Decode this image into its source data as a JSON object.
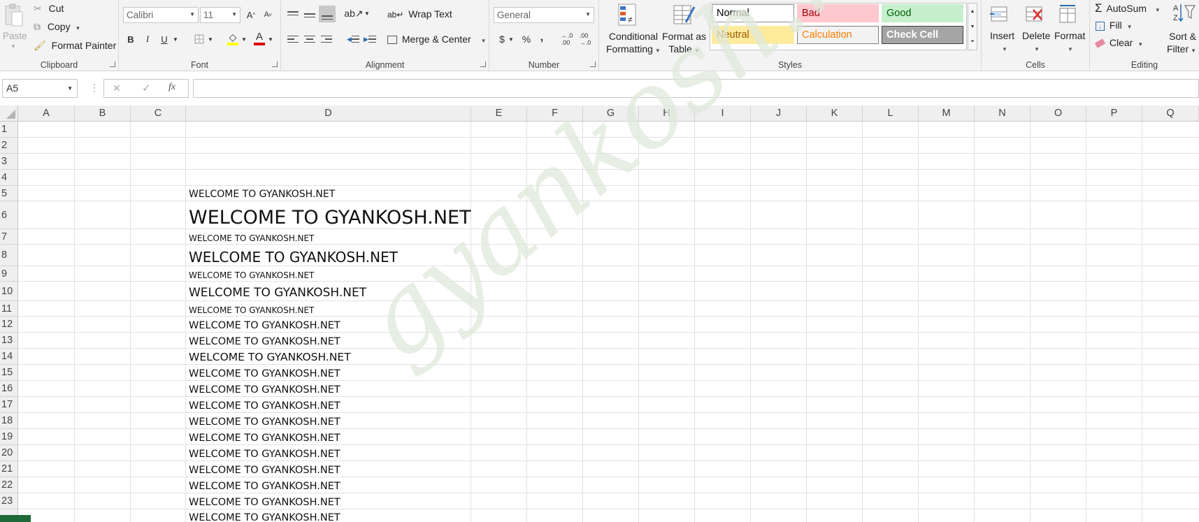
{
  "clipboard": {
    "paste": "Paste",
    "cut": "Cut",
    "copy": "Copy",
    "format_painter": "Format Painter",
    "title": "Clipboard"
  },
  "font": {
    "name": "Calibri",
    "size": "11",
    "bold": "B",
    "italic": "I",
    "underline": "U",
    "title": "Font"
  },
  "alignment": {
    "wrap_text": "Wrap Text",
    "merge_center": "Merge & Center",
    "title": "Alignment"
  },
  "number": {
    "format": "General",
    "currency": "$",
    "percent": "%",
    "comma": ",",
    "title": "Number"
  },
  "styles_group": {
    "conditional_formatting": [
      "Conditional",
      "Formatting"
    ],
    "format_as_table": [
      "Format as",
      "Table"
    ],
    "items": [
      {
        "label": "Normal",
        "bg": "#ffffff",
        "color": "#000000",
        "border": "#8f8f8f"
      },
      {
        "label": "Bad",
        "bg": "#ffc7ce",
        "color": "#9c0006",
        "border": "#ffc7ce"
      },
      {
        "label": "Good",
        "bg": "#c6efce",
        "color": "#006100",
        "border": "#c6efce"
      },
      {
        "label": "Neutral",
        "bg": "#ffeb9c",
        "color": "#9c5700",
        "border": "#ffeb9c"
      },
      {
        "label": "Calculation",
        "bg": "#f2f2f2",
        "color": "#fa7d00",
        "border": "#7f7f7f"
      },
      {
        "label": "Check Cell",
        "bg": "#a5a5a5",
        "color": "#ffffff",
        "border": "#3f3f3f"
      }
    ],
    "title": "Styles"
  },
  "cells_group": {
    "insert": "Insert",
    "delete": "Delete",
    "format": "Format",
    "title": "Cells"
  },
  "editing": {
    "autosum": "AutoSum",
    "fill": "Fill",
    "clear": "Clear",
    "sort_filter": [
      "Sort &",
      "Filter"
    ],
    "title": "Editing"
  },
  "formula_bar": {
    "name_box": "A5",
    "cancel": "✕",
    "enter": "✓",
    "fx": "fx",
    "value": ""
  },
  "sheet": {
    "columns": [
      "A",
      "B",
      "C",
      "D",
      "E",
      "F",
      "G",
      "H",
      "I",
      "J",
      "K",
      "L",
      "M",
      "N",
      "O",
      "P",
      "Q"
    ],
    "rows": [
      "1",
      "2",
      "3",
      "4",
      "5",
      "6",
      "7",
      "8",
      "9",
      "10",
      "11",
      "12",
      "13",
      "14",
      "15",
      "16",
      "17",
      "18",
      "19",
      "20",
      "21",
      "22",
      "23"
    ],
    "cell_text": "WELCOME TO GYANKOSH.NET",
    "watermark": "gyankosh.net"
  }
}
